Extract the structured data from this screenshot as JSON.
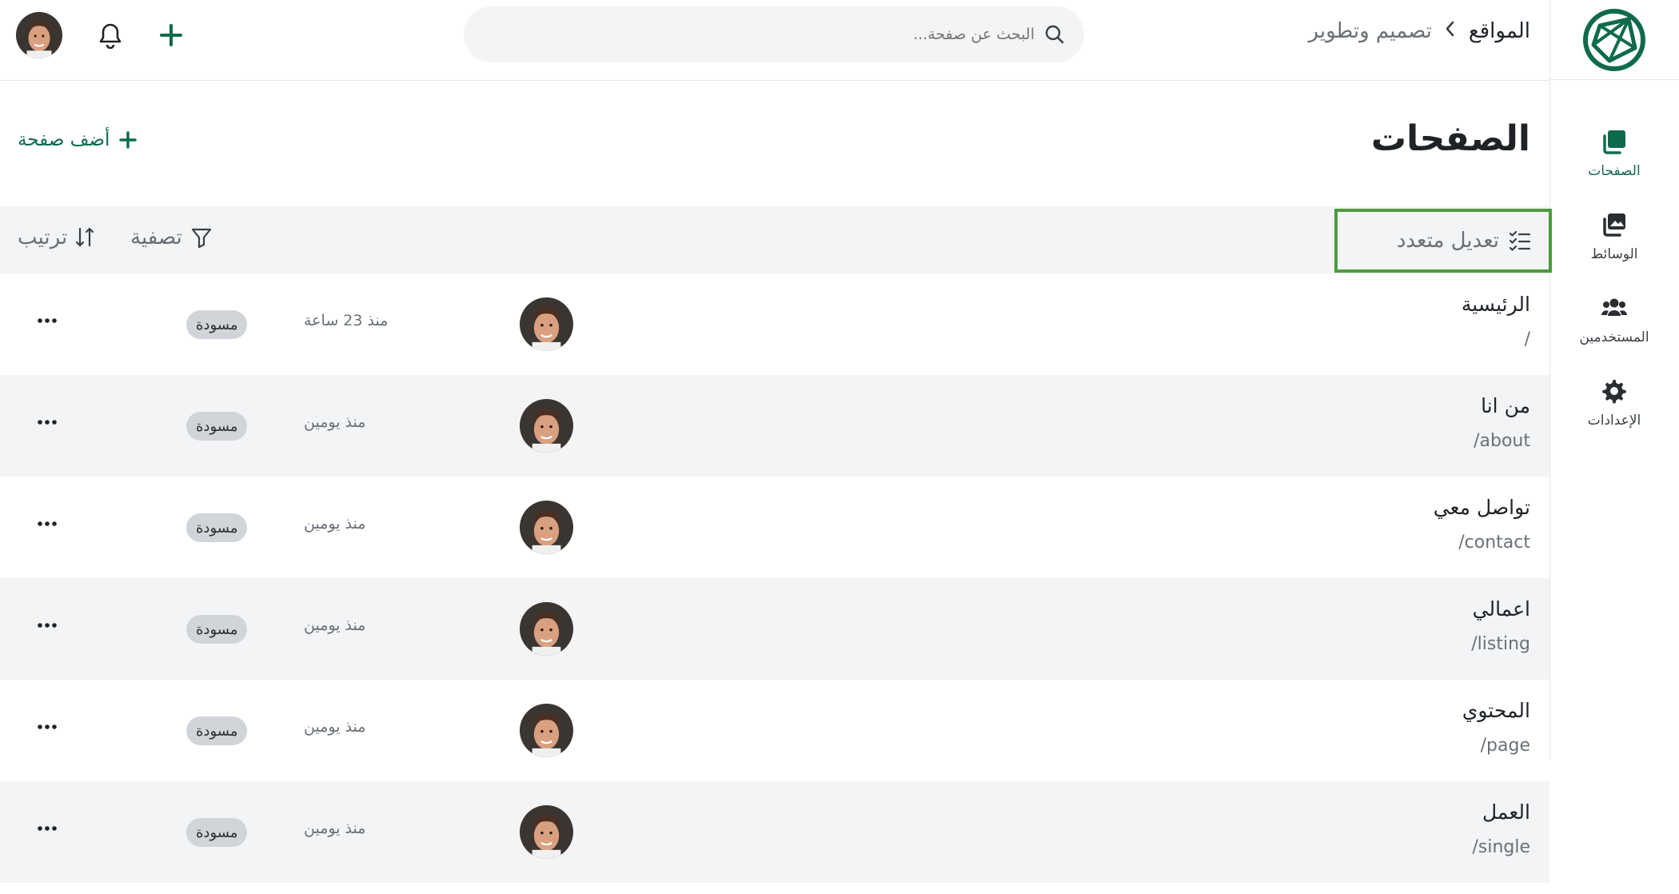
{
  "topbar": {
    "breadcrumb": {
      "root": "المواقع",
      "separator": "›",
      "current": "تصميم وتطوير"
    },
    "search_placeholder": "البحث عن صفحة..."
  },
  "sidebar": {
    "items": [
      {
        "label": "الصفحات",
        "icon": "pages-icon",
        "active": true
      },
      {
        "label": "الوسائط",
        "icon": "media-icon",
        "active": false
      },
      {
        "label": "المستخدمين",
        "icon": "users-icon",
        "active": false
      },
      {
        "label": "الإعدادات",
        "icon": "gear-icon",
        "active": false
      }
    ]
  },
  "header": {
    "title": "الصفحات",
    "add_label": "أضف صفحة"
  },
  "toolbar": {
    "bulk_edit": "تعديل متعدد",
    "filter": "تصفية",
    "sort": "ترتيب"
  },
  "pages": [
    {
      "title": "الرئيسية",
      "slug": "/",
      "time": "منذ 23 ساعة",
      "status": "مسودة"
    },
    {
      "title": "من انا",
      "slug": "/about",
      "time": "منذ يومين",
      "status": "مسودة"
    },
    {
      "title": "تواصل معي",
      "slug": "/contact",
      "time": "منذ يومين",
      "status": "مسودة"
    },
    {
      "title": "اعمالي",
      "slug": "/listing",
      "time": "منذ يومين",
      "status": "مسودة"
    },
    {
      "title": "المحتوي",
      "slug": "/page",
      "time": "منذ يومين",
      "status": "مسودة"
    },
    {
      "title": "العمل",
      "slug": "/single",
      "time": "منذ يومين",
      "status": "مسودة"
    }
  ],
  "colors": {
    "accent": "#0e6b4a",
    "highlight_border": "#4c9a3f",
    "row_alt": "#f3f4f6"
  }
}
